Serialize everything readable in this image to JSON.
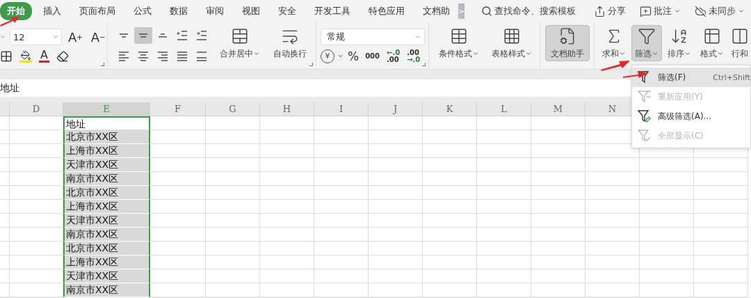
{
  "tabs": [
    {
      "label": "开始",
      "selected": true
    },
    {
      "label": "插入",
      "selected": false
    },
    {
      "label": "页面布局",
      "selected": false
    },
    {
      "label": "公式",
      "selected": false
    },
    {
      "label": "数据",
      "selected": false
    },
    {
      "label": "审阅",
      "selected": false
    },
    {
      "label": "视图",
      "selected": false
    },
    {
      "label": "安全",
      "selected": false
    },
    {
      "label": "开发工具",
      "selected": false
    },
    {
      "label": "特色应用",
      "selected": false
    },
    {
      "label": "文档助",
      "selected": false
    }
  ],
  "tab_scroll": ">",
  "search": {
    "placeholder": "查找命令、搜索模板"
  },
  "top_actions": [
    {
      "kind": "share",
      "label": "分享",
      "dropdown": false
    },
    {
      "kind": "comment",
      "label": "批注",
      "dropdown": true
    },
    {
      "kind": "sync",
      "label": "未同步",
      "dropdown": true
    }
  ],
  "font": {
    "size": "12",
    "grow": {
      "letter": "A",
      "sign": "+"
    },
    "shrink": {
      "letter": "A",
      "sign": "−"
    },
    "color_letter": "A"
  },
  "alignment_buttons": [
    {
      "kind": "top",
      "selected": false
    },
    {
      "kind": "middle",
      "selected": true
    },
    {
      "kind": "bottom",
      "selected": false
    },
    {
      "kind": "outdent",
      "selected": false
    },
    {
      "kind": "indent",
      "selected": false
    },
    {
      "kind": "left",
      "selected": false
    },
    {
      "kind": "center",
      "selected": false
    },
    {
      "kind": "right",
      "selected": false
    },
    {
      "kind": "justify",
      "selected": false
    },
    {
      "kind": "distributed",
      "selected": false
    }
  ],
  "merge_buttons": [
    {
      "kind": "merge",
      "label": "合并居中",
      "dropdown": true
    },
    {
      "kind": "wrap",
      "label": "自动换行",
      "dropdown": false
    }
  ],
  "number": {
    "format": "常规",
    "currency": "¥",
    "percent": "%",
    "thousands": "000",
    "decimals": [
      {
        "kind": "increase",
        "top": "←.0",
        "bottom": ".00"
      },
      {
        "kind": "decrease",
        "top": ".00",
        "bottom": "→.0"
      }
    ]
  },
  "style_buttons": [
    {
      "kind": "conditional",
      "label": "条件格式",
      "dropdown": true
    },
    {
      "kind": "table-style",
      "label": "表格样式",
      "dropdown": true
    }
  ],
  "assistant": {
    "label": "文档助手",
    "selected": true
  },
  "edit_buttons": [
    {
      "kind": "sum",
      "label": "求和",
      "dropdown": true,
      "selected": false
    },
    {
      "kind": "filter",
      "label": "筛选",
      "dropdown": true,
      "selected": true
    },
    {
      "kind": "sort",
      "label": "排序",
      "dropdown": true,
      "selected": false
    },
    {
      "kind": "format",
      "label": "格式",
      "dropdown": true,
      "selected": false
    },
    {
      "kind": "rows-cols",
      "label": "行和",
      "dropdown": false,
      "selected": false
    }
  ],
  "formula_bar": {
    "value": "地址"
  },
  "sheet": {
    "columns": [
      {
        "label": "D",
        "selected": false
      },
      {
        "label": "E",
        "selected": true
      },
      {
        "label": "F",
        "selected": false
      },
      {
        "label": "G",
        "selected": false
      },
      {
        "label": "H",
        "selected": false
      },
      {
        "label": "I",
        "selected": false
      },
      {
        "label": "J",
        "selected": false
      },
      {
        "label": "K",
        "selected": false
      },
      {
        "label": "L",
        "selected": false
      },
      {
        "label": "M",
        "selected": false
      },
      {
        "label": "N",
        "selected": false
      }
    ],
    "selection": [
      {
        "value": "地址",
        "selected": false
      },
      {
        "value": "北京市XX区",
        "selected": true
      },
      {
        "value": "上海市XX区",
        "selected": true
      },
      {
        "value": "天津市XX区",
        "selected": true
      },
      {
        "value": "南京市XX区",
        "selected": true
      },
      {
        "value": "北京市XX区",
        "selected": true
      },
      {
        "value": "上海市XX区",
        "selected": true
      },
      {
        "value": "天津市XX区",
        "selected": true
      },
      {
        "value": "南京市XX区",
        "selected": true
      },
      {
        "value": "北京市XX区",
        "selected": true
      },
      {
        "value": "上海市XX区",
        "selected": true
      },
      {
        "value": "天津市XX区",
        "selected": true
      },
      {
        "value": "南京市XX区",
        "selected": true
      }
    ]
  },
  "filter_menu": {
    "items": [
      {
        "kind": "filter",
        "label": "筛选(F)",
        "shortcut": "Ctrl+Shift",
        "selected": true,
        "disabled": false
      },
      {
        "kind": "reapply",
        "label": "重新应用(Y)",
        "selected": false,
        "disabled": true
      },
      {
        "kind": "advanced",
        "label": "高级筛选(A)...",
        "selected": false,
        "disabled": false
      },
      {
        "kind": "show-all",
        "label": "全部显示(C)",
        "selected": false,
        "disabled": true
      }
    ]
  }
}
